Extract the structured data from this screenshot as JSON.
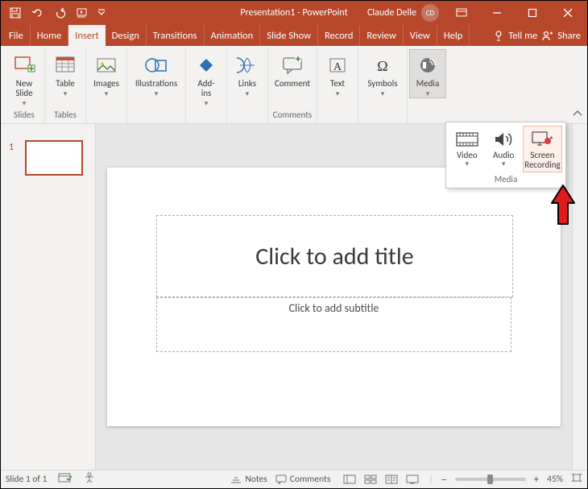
{
  "titlebar": {
    "doc_name": "Presentation1",
    "app_name": "PowerPoint",
    "user_name": "Claude Delle",
    "user_initials": "CD"
  },
  "tabs": {
    "file": "File",
    "home": "Home",
    "insert": "Insert",
    "design": "Design",
    "transitions": "Transitions",
    "animations": "Animation",
    "slideshow": "Slide Show",
    "record": "Record",
    "review": "Review",
    "view": "View",
    "help": "Help",
    "tell_me": "Tell me",
    "share": "Share"
  },
  "ribbon": {
    "new_slide": "New\nSlide",
    "table": "Table",
    "images": "Images",
    "illustrations": "Illustrations",
    "addins": "Add-\nins",
    "links": "Links",
    "comment": "Comment",
    "text": "Text",
    "symbols": "Symbols",
    "media": "Media",
    "group_slides": "Slides",
    "group_tables": "Tables",
    "group_comments": "Comments"
  },
  "media_dropdown": {
    "video": "Video",
    "audio": "Audio",
    "screen_recording": "Screen Recording",
    "category": "Media"
  },
  "thumbnails": {
    "slide1_number": "1"
  },
  "slide": {
    "title_placeholder": "Click to add title",
    "subtitle_placeholder": "Click to add subtitle"
  },
  "statusbar": {
    "slide_info": "Slide 1 of 1",
    "notes": "Notes",
    "comments": "Comments",
    "zoom_minus": "−",
    "zoom_plus": "+",
    "zoom_label": "45%"
  }
}
